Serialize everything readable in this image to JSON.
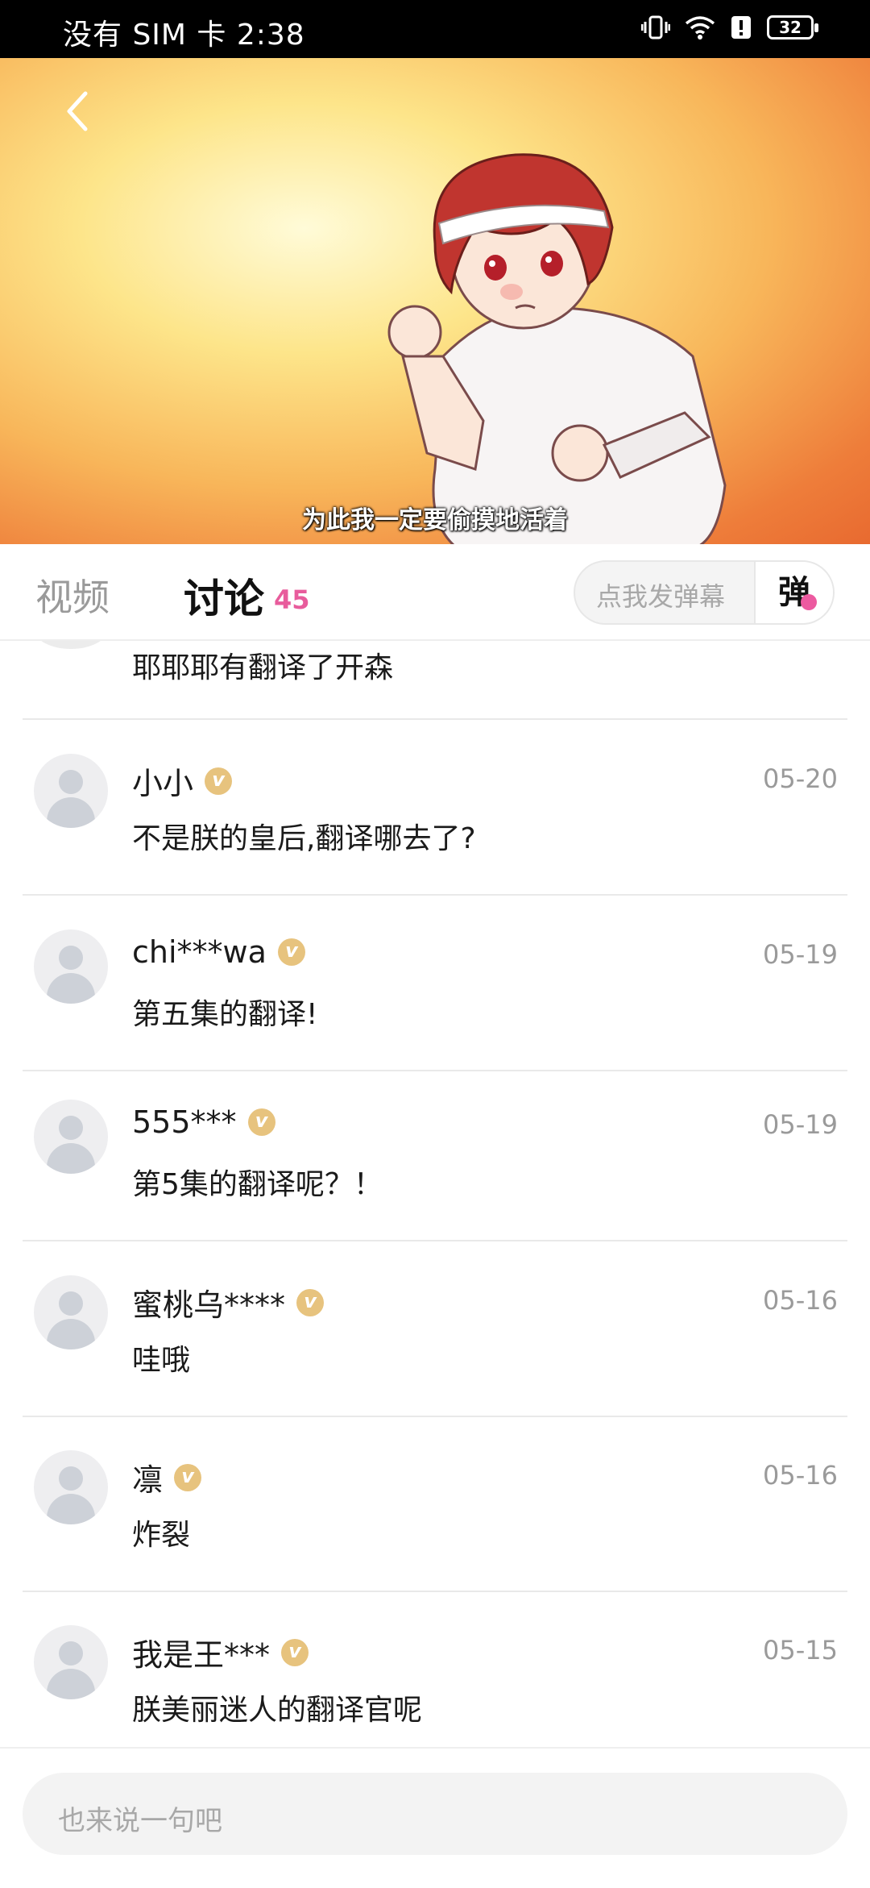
{
  "status_bar": {
    "carrier_time": "没有 SIM 卡 2:38",
    "battery": "32"
  },
  "video": {
    "subtitle": "为此我一定要偷摸地活着"
  },
  "tabs": {
    "video_label": "视频",
    "discussion_label": "讨论",
    "discussion_count": "45",
    "danmaku_placeholder": "点我发弹幕",
    "danmaku_button": "弹"
  },
  "comments": {
    "partial_text": "耶耶耶有翻译了开森",
    "items": [
      {
        "user": "小小",
        "date": "05-20",
        "text": "不是朕的皇后,翻译哪去了?"
      },
      {
        "user": "chi***wa",
        "date": "05-19",
        "text": "第五集的翻译!"
      },
      {
        "user": "555***",
        "date": "05-19",
        "text": "第5集的翻译呢？！"
      },
      {
        "user": "蜜桃乌****",
        "date": "05-16",
        "text": "哇哦"
      },
      {
        "user": "凛",
        "date": "05-16",
        "text": "炸裂"
      },
      {
        "user": "我是王***",
        "date": "05-15",
        "text": "朕美丽迷人的翻译官呢"
      }
    ]
  },
  "input": {
    "placeholder": "也来说一句吧"
  },
  "colors": {
    "accent_pink": "#e85c9c",
    "verified_gold": "#e7c37e"
  },
  "icons": [
    "back-icon",
    "vibrate-icon",
    "wifi-icon",
    "alert-icon",
    "battery-icon",
    "verified-icon",
    "default-avatar-icon"
  ]
}
